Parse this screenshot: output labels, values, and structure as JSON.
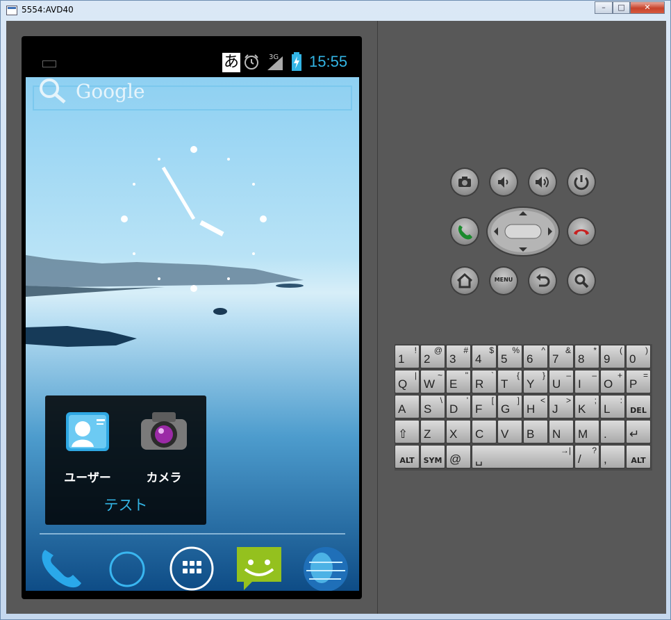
{
  "window": {
    "title": "5554:AVD40",
    "minimize": "–",
    "maximize": "□",
    "close": "✕"
  },
  "status_bar": {
    "ime": "あ",
    "network": "3G",
    "time": "15:55"
  },
  "search": {
    "label": "Google"
  },
  "clock": {
    "hour": 3,
    "minute": 55
  },
  "folder": {
    "name": "テスト",
    "apps": [
      "ユーザー",
      "カメラ"
    ]
  },
  "dock": [
    "phone",
    "browser-circle",
    "all-apps",
    "messaging",
    "globe"
  ],
  "controls": {
    "menu_label": "MENU"
  },
  "keyboard": {
    "rows": [
      [
        {
          "m": "1",
          "s": "!"
        },
        {
          "m": "2",
          "s": "@"
        },
        {
          "m": "3",
          "s": "#"
        },
        {
          "m": "4",
          "s": "$"
        },
        {
          "m": "5",
          "s": "%"
        },
        {
          "m": "6",
          "s": "^"
        },
        {
          "m": "7",
          "s": "&"
        },
        {
          "m": "8",
          "s": "*"
        },
        {
          "m": "9",
          "s": "("
        },
        {
          "m": "0",
          "s": ")"
        }
      ],
      [
        {
          "m": "Q",
          "s": "|"
        },
        {
          "m": "W",
          "s": "~"
        },
        {
          "m": "E",
          "s": "\""
        },
        {
          "m": "R",
          "s": "`"
        },
        {
          "m": "T",
          "s": "{"
        },
        {
          "m": "Y",
          "s": "}"
        },
        {
          "m": "U",
          "s": "–"
        },
        {
          "m": "I",
          "s": "–"
        },
        {
          "m": "O",
          "s": "+"
        },
        {
          "m": "P",
          "s": "="
        }
      ],
      [
        {
          "m": "A",
          "s": ""
        },
        {
          "m": "S",
          "s": "\\"
        },
        {
          "m": "D",
          "s": "'"
        },
        {
          "m": "F",
          "s": "["
        },
        {
          "m": "G",
          "s": "]"
        },
        {
          "m": "H",
          "s": "<"
        },
        {
          "m": "J",
          "s": ">"
        },
        {
          "m": "K",
          "s": ";"
        },
        {
          "m": "L",
          "s": ":"
        },
        {
          "m": "DEL",
          "s": ""
        }
      ],
      [
        {
          "m": "⇧",
          "s": ""
        },
        {
          "m": "Z",
          "s": ""
        },
        {
          "m": "X",
          "s": ""
        },
        {
          "m": "C",
          "s": ""
        },
        {
          "m": "V",
          "s": ""
        },
        {
          "m": "B",
          "s": ""
        },
        {
          "m": "N",
          "s": ""
        },
        {
          "m": "M",
          "s": ""
        },
        {
          "m": ".",
          "s": ""
        },
        {
          "m": "↵",
          "s": ""
        }
      ],
      [
        {
          "m": "ALT",
          "s": ""
        },
        {
          "m": "SYM",
          "s": ""
        },
        {
          "m": "@",
          "s": ""
        },
        {
          "m": "␣",
          "s": "→|"
        },
        {
          "m": "/",
          "s": "?"
        },
        {
          "m": ",",
          "s": ""
        },
        {
          "m": "ALT",
          "s": ""
        }
      ]
    ]
  }
}
